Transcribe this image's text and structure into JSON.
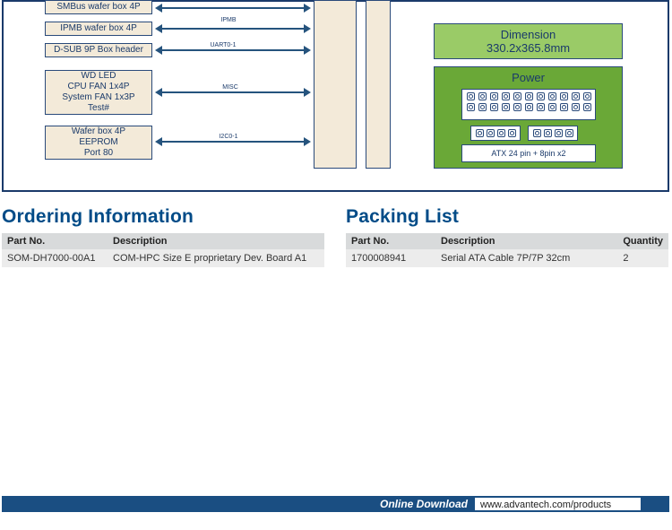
{
  "diagram": {
    "left_boxes": [
      {
        "id": "smbus",
        "label": "SMBus wafer box 4P"
      },
      {
        "id": "ipmb",
        "label": "IPMB wafer box 4P"
      },
      {
        "id": "dsub",
        "label": "D-SUB 9P Box header"
      },
      {
        "id": "group1",
        "lines": [
          "WD LED",
          "CPU FAN 1x4P",
          "System FAN 1x3P",
          "Test#"
        ]
      },
      {
        "id": "group2",
        "lines": [
          "Wafer box 4P",
          "EEPROM",
          "Port 80"
        ]
      }
    ],
    "arrow_labels": {
      "ipmb": "IPMB",
      "uart": "UART0-1",
      "misc": "MISC",
      "i2c": "I2C0-1"
    },
    "right_panels": {
      "dimension_title": "Dimension",
      "dimension_value": "330.2x365.8mm",
      "power_title": "Power",
      "power_label": "ATX 24 pin + 8pin x2"
    }
  },
  "ordering": {
    "heading": "Ordering Information",
    "cols": {
      "partno": "Part No.",
      "desc": "Description"
    },
    "rows": [
      {
        "partno": "SOM-DH7000-00A1",
        "desc": "COM-HPC Size E proprietary Dev. Board A1"
      }
    ]
  },
  "packing": {
    "heading": "Packing List",
    "cols": {
      "partno": "Part No.",
      "desc": "Description",
      "qty": "Quantity"
    },
    "rows": [
      {
        "partno": "1700008941",
        "desc": "Serial ATA Cable 7P/7P 32cm",
        "qty": "2"
      }
    ]
  },
  "footer": {
    "download": "Online Download",
    "url": "www.advantech.com/products"
  }
}
